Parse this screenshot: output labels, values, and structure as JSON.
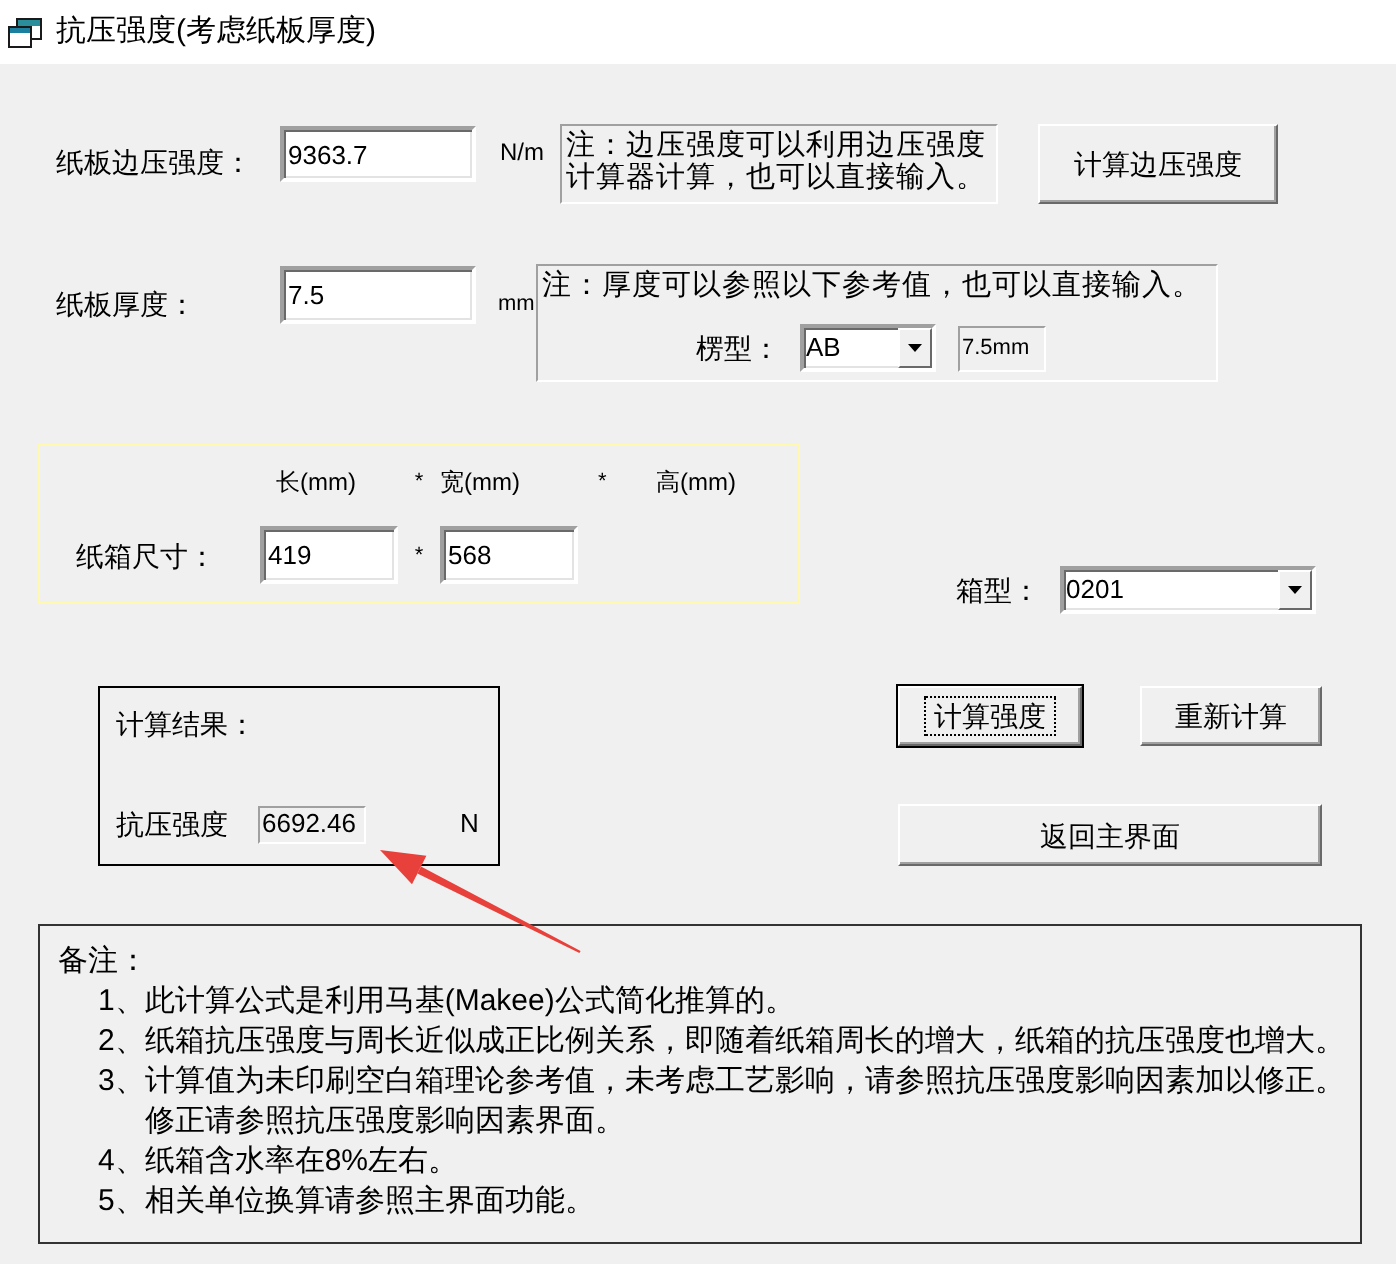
{
  "window": {
    "title": "抗压强度(考虑纸板厚度)"
  },
  "edge_crush": {
    "label": "纸板边压强度：",
    "value": "9363.7",
    "unit": "N/m",
    "note": "注：边压强度可以利用边压强度计算器计算，也可以直接输入。",
    "button": {
      "label": "计算边压强度",
      "focused": false
    }
  },
  "thickness": {
    "label": "纸板厚度：",
    "value": "7.5",
    "unit": "mm",
    "note": "注：厚度可以参照以下参考值，也可以直接输入。",
    "flute_label": "楞型：",
    "flute_value": "AB",
    "flute_thickness": "7.5mm"
  },
  "box_size": {
    "headers": [
      "长(mm)",
      "宽(mm)",
      "高(mm)"
    ],
    "header_separators": [
      "*",
      "*"
    ],
    "label": "纸箱尺寸：",
    "values": [
      "419",
      "568"
    ],
    "value_separator": "*"
  },
  "box_type": {
    "label": "箱型：",
    "value": "0201"
  },
  "result": {
    "title": "计算结果：",
    "label": "抗压强度",
    "value": "6692.46",
    "unit": "N"
  },
  "buttons": [
    {
      "label": "计算强度",
      "focused": true
    },
    {
      "label": "重新计算",
      "focused": false
    },
    {
      "label": "返回主界面",
      "focused": false
    }
  ],
  "notes": {
    "title": "备注：",
    "items": [
      {
        "marker": "1、",
        "text": "此计算公式是利用马基(Makee)公式简化推算的。"
      },
      {
        "marker": "2、",
        "text": "纸箱抗压强度与周长近似成正比例关系，即随着纸箱周长的增大，纸箱的抗压强度也增大。"
      },
      {
        "marker": "3、",
        "text": "计算值为未印刷空白箱理论参考值，未考虑工艺影响，请参照抗压强度影响因素加以修正。修正请参照抗压强度影响因素界面。"
      },
      {
        "marker": "4、",
        "text": "纸箱含水率在8%左右。"
      },
      {
        "marker": "5、",
        "text": "相关单位换算请参照主界面功能。"
      }
    ]
  }
}
